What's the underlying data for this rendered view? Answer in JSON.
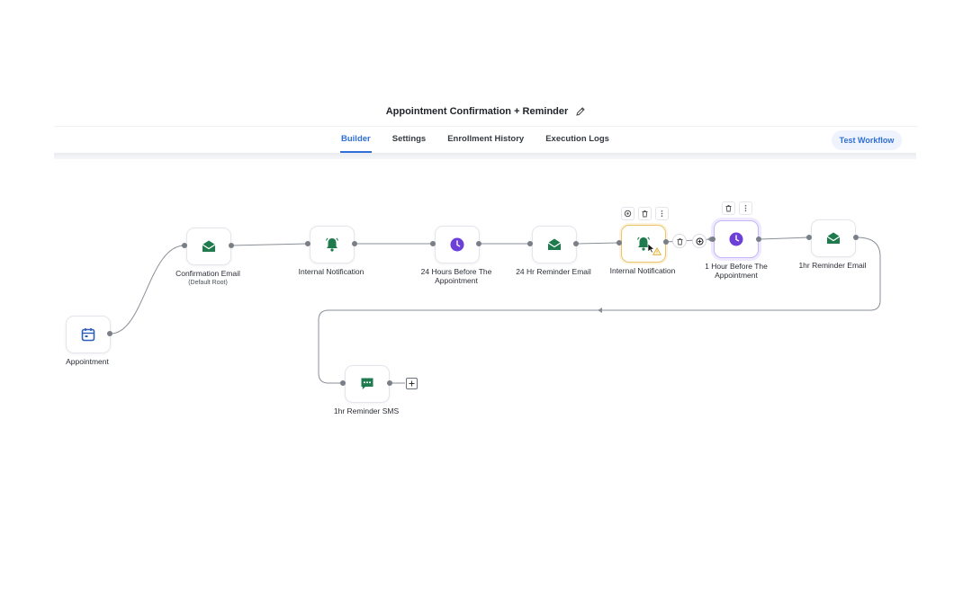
{
  "header": {
    "title": "Appointment Confirmation + Reminder",
    "tabs": [
      {
        "label": "Builder",
        "active": true
      },
      {
        "label": "Settings",
        "active": false
      },
      {
        "label": "Enrollment History",
        "active": false
      },
      {
        "label": "Execution Logs",
        "active": false
      }
    ],
    "test_button": "Test Workflow"
  },
  "colors": {
    "accent_blue": "#2f6fd6",
    "email_green": "#1f7a4d",
    "wait_purple": "#6b3fd8",
    "warning_yellow": "#e9b949",
    "trigger_blue": "#2d5fb8"
  },
  "nodes": [
    {
      "id": "appointment",
      "label": "Appointment",
      "icon": "calendar-icon"
    },
    {
      "id": "confirmation-email",
      "label": "Confirmation Email",
      "sublabel": "(Default Root)",
      "icon": "email-icon"
    },
    {
      "id": "internal-notification-1",
      "label": "Internal Notification",
      "icon": "bell-icon"
    },
    {
      "id": "wait-24h",
      "label": "24 Hours Before The Appointment",
      "icon": "clock-icon"
    },
    {
      "id": "reminder-email-24h",
      "label": "24 Hr Reminder Email",
      "icon": "email-icon"
    },
    {
      "id": "internal-notification-2",
      "label": "Internal Notification",
      "icon": "bell-icon",
      "warning": true
    },
    {
      "id": "wait-1h",
      "label": "1 Hour Before The Appointment",
      "icon": "clock-icon"
    },
    {
      "id": "reminder-email-1h",
      "label": "1hr Reminder Email",
      "icon": "email-icon"
    },
    {
      "id": "reminder-sms-1h",
      "label": "1hr Reminder SMS",
      "icon": "sms-icon"
    }
  ]
}
